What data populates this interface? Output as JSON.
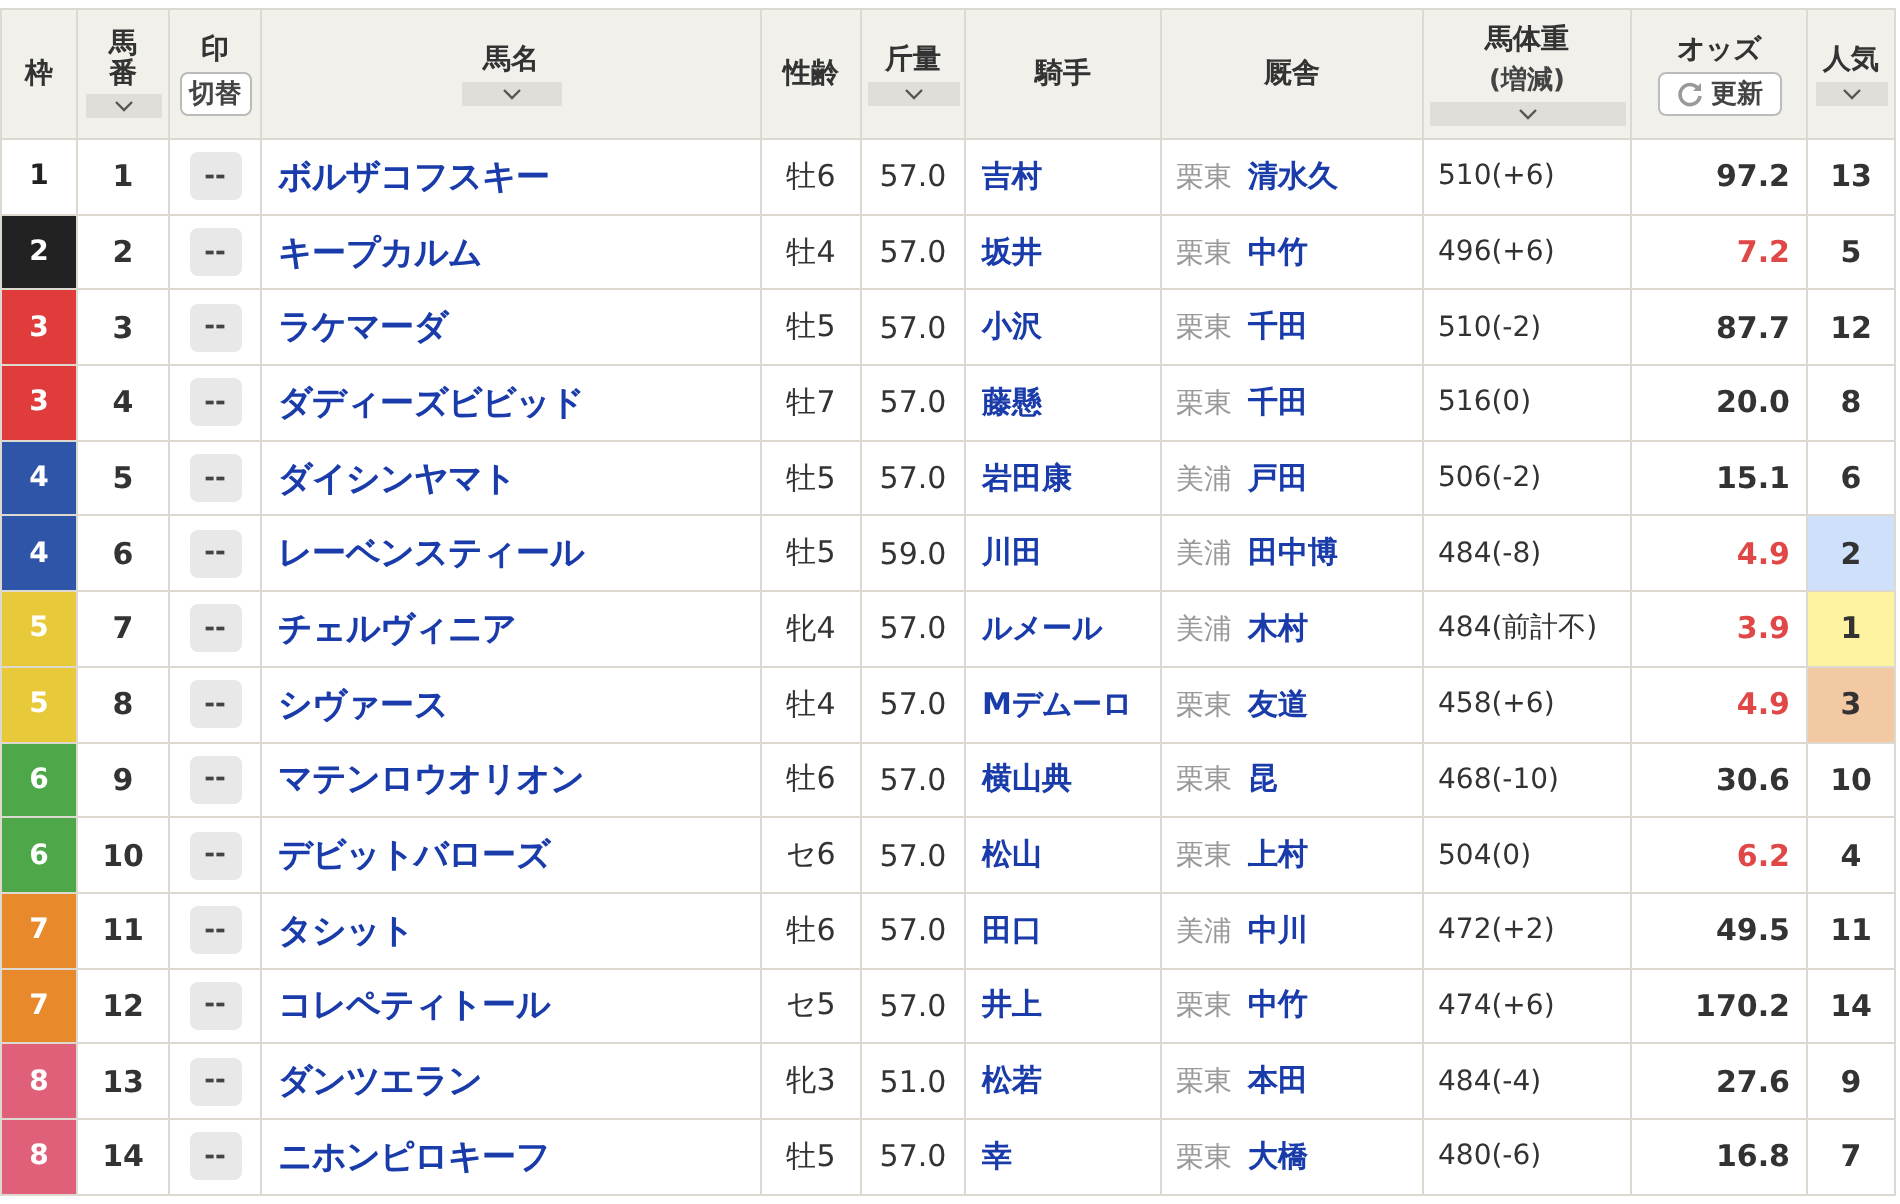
{
  "columns": [
    {
      "label": "枠",
      "sortable": false
    },
    {
      "label": "馬番",
      "sortable": true
    },
    {
      "label": "印",
      "sortable": false,
      "button": "切替"
    },
    {
      "label": "馬名",
      "sortable": true
    },
    {
      "label": "性齢",
      "sortable": false
    },
    {
      "label": "斤量",
      "sortable": true
    },
    {
      "label": "騎手",
      "sortable": false
    },
    {
      "label": "厩舎",
      "sortable": false
    },
    {
      "label": "馬体重",
      "sub": "(増減)",
      "sortable": true
    },
    {
      "label": "オッズ",
      "sortable": false,
      "button": "更新"
    },
    {
      "label": "人気",
      "sortable": true
    }
  ],
  "rows": [
    {
      "frame": "1",
      "color": "#ffffff",
      "number": "1",
      "mark": "--",
      "name": "ボルザコフスキー",
      "sex_age": "牡6",
      "weight": "57.0",
      "jockey": "吉村",
      "region": "栗東",
      "trainer": "清水久",
      "body": "510(+6)",
      "odds": "97.2",
      "low_odds": false,
      "pop": {
        "text": "13"
      }
    },
    {
      "frame": "2",
      "color": "#222222",
      "number": "2",
      "mark": "--",
      "name": "キープカルム",
      "sex_age": "牡4",
      "weight": "57.0",
      "jockey": "坂井",
      "region": "栗東",
      "trainer": "中竹",
      "body": "496(+6)",
      "odds": "7.2",
      "low_odds": true,
      "pop": {
        "text": "5"
      }
    },
    {
      "frame": "3",
      "color": "#e03c3c",
      "number": "3",
      "mark": "--",
      "name": "ラケマーダ",
      "sex_age": "牡5",
      "weight": "57.0",
      "jockey": "小沢",
      "region": "栗東",
      "trainer": "千田",
      "body": "510(-2)",
      "odds": "87.7",
      "low_odds": false,
      "pop": {
        "text": "12"
      }
    },
    {
      "frame": "3",
      "color": "#e03c3c",
      "number": "4",
      "mark": "--",
      "name": "ダディーズビビッド",
      "sex_age": "牡7",
      "weight": "57.0",
      "jockey": "藤懸",
      "region": "栗東",
      "trainer": "千田",
      "body": "516(0)",
      "odds": "20.0",
      "low_odds": false,
      "pop": {
        "text": "8"
      }
    },
    {
      "frame": "4",
      "color": "#2f55a8",
      "number": "5",
      "mark": "--",
      "name": "ダイシンヤマト",
      "sex_age": "牡5",
      "weight": "57.0",
      "jockey": "岩田康",
      "region": "美浦",
      "trainer": "戸田",
      "body": "506(-2)",
      "odds": "15.1",
      "low_odds": false,
      "pop": {
        "text": "6"
      }
    },
    {
      "frame": "4",
      "color": "#2f55a8",
      "number": "6",
      "mark": "--",
      "name": "レーベンスティール",
      "sex_age": "牡5",
      "weight": "59.0",
      "jockey": "川田",
      "region": "美浦",
      "trainer": "田中博",
      "body": "484(-8)",
      "odds": "4.9",
      "low_odds": true,
      "pop": {
        "text": "2",
        "color": "#cfe0fb"
      }
    },
    {
      "frame": "5",
      "color": "#e8c93a",
      "number": "7",
      "mark": "--",
      "name": "チェルヴィニア",
      "sex_age": "牝4",
      "weight": "57.0",
      "jockey": "ルメール",
      "region": "美浦",
      "trainer": "木村",
      "body": "484(前計不)",
      "odds": "3.9",
      "low_odds": true,
      "pop": {
        "text": "1",
        "color": "#fdf3a0"
      }
    },
    {
      "frame": "5",
      "color": "#e8c93a",
      "number": "8",
      "mark": "--",
      "name": "シヴァース",
      "sex_age": "牡4",
      "weight": "57.0",
      "jockey": "Mデムーロ",
      "region": "栗東",
      "trainer": "友道",
      "body": "458(+6)",
      "odds": "4.9",
      "low_odds": true,
      "pop": {
        "text": "3",
        "color": "#f2c9a3"
      }
    },
    {
      "frame": "6",
      "color": "#4ea84a",
      "number": "9",
      "mark": "--",
      "name": "マテンロウオリオン",
      "sex_age": "牡6",
      "weight": "57.0",
      "jockey": "横山典",
      "region": "栗東",
      "trainer": "昆",
      "body": "468(-10)",
      "odds": "30.6",
      "low_odds": false,
      "pop": {
        "text": "10"
      }
    },
    {
      "frame": "6",
      "color": "#4ea84a",
      "number": "10",
      "mark": "--",
      "name": "デビットバローズ",
      "sex_age": "セ6",
      "weight": "57.0",
      "jockey": "松山",
      "region": "栗東",
      "trainer": "上村",
      "body": "504(0)",
      "odds": "6.2",
      "low_odds": true,
      "pop": {
        "text": "4"
      }
    },
    {
      "frame": "7",
      "color": "#e8892c",
      "number": "11",
      "mark": "--",
      "name": "タシット",
      "sex_age": "牡6",
      "weight": "57.0",
      "jockey": "田口",
      "region": "美浦",
      "trainer": "中川",
      "body": "472(+2)",
      "odds": "49.5",
      "low_odds": false,
      "pop": {
        "text": "11"
      }
    },
    {
      "frame": "7",
      "color": "#e8892c",
      "number": "12",
      "mark": "--",
      "name": "コレペティトール",
      "sex_age": "セ5",
      "weight": "57.0",
      "jockey": "井上",
      "region": "栗東",
      "trainer": "中竹",
      "body": "474(+6)",
      "odds": "170.2",
      "low_odds": false,
      "pop": {
        "text": "14"
      }
    },
    {
      "frame": "8",
      "color": "#e0607a",
      "number": "13",
      "mark": "--",
      "name": "ダンツエラン",
      "sex_age": "牝3",
      "weight": "51.0",
      "jockey": "松若",
      "region": "栗東",
      "trainer": "本田",
      "body": "484(-4)",
      "odds": "27.6",
      "low_odds": false,
      "pop": {
        "text": "9"
      }
    },
    {
      "frame": "8",
      "color": "#e0607a",
      "number": "14",
      "mark": "--",
      "name": "ニホンピロキーフ",
      "sex_age": "牡5",
      "weight": "57.0",
      "jockey": "幸",
      "region": "栗東",
      "trainer": "大橋",
      "body": "480(-6)",
      "odds": "16.8",
      "low_odds": false,
      "pop": {
        "text": "7"
      }
    }
  ]
}
